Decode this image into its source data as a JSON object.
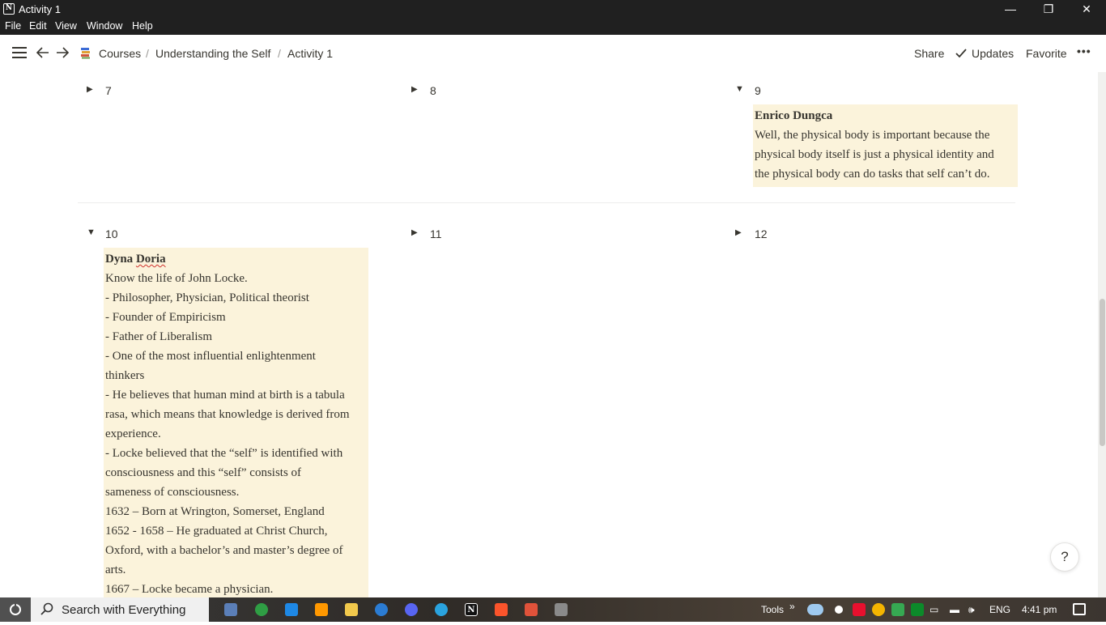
{
  "window": {
    "title": "Activity 1",
    "controls": {
      "minimize": "—",
      "restore": "❐",
      "close": "✕"
    }
  },
  "menu": [
    "File",
    "Edit",
    "View",
    "Window",
    "Help"
  ],
  "topbar": {
    "breadcrumb": [
      "Courses",
      "Understanding the Self",
      "Activity 1"
    ],
    "separator": "/",
    "share": "Share",
    "updates": "Updates",
    "favorite": "Favorite",
    "more": "•••"
  },
  "grid": {
    "row1": [
      {
        "number": "7",
        "expanded": false
      },
      {
        "number": "8",
        "expanded": false
      },
      {
        "number": "9",
        "expanded": true
      }
    ],
    "row2": [
      {
        "number": "10",
        "expanded": true
      },
      {
        "number": "11",
        "expanded": false
      },
      {
        "number": "12",
        "expanded": false
      }
    ]
  },
  "notes": {
    "n9": {
      "author": "Enrico Dungca",
      "lines": [
        "Well, the physical body is important because the",
        "physical body itself is just a physical identity and",
        "the physical body can do tasks that self can’t do."
      ]
    },
    "n10": {
      "author_first": "Dyna",
      "author_last": "Doria",
      "lines": [
        "Know the life of John Locke.",
        " - Philosopher, Physician, Political theorist",
        "- Founder of Empiricism",
        " - Father of Liberalism",
        " - One of the most influential enlightenment",
        "thinkers",
        "- He believes that human mind at birth is a tabula",
        "rasa, which means that knowledge is derived from",
        "experience.",
        "- Locke believed that the “self” is identified with",
        "consciousness and this “self” consists of",
        "sameness of consciousness.",
        "1632 – Born at Wrington, Somerset, England",
        "1652 - 1658 – He graduated at Christ Church,",
        "Oxford, with a bachelor’s and master’s degree of",
        "arts.",
        "1667 – Locke became a physician."
      ]
    }
  },
  "help_label": "?",
  "taskbar": {
    "search": "Search with Everything",
    "tools": "Tools",
    "lang": "ENG",
    "time": "4:41 pm"
  },
  "colors": {
    "note_bg": "#fbf3db",
    "text": "#37352f",
    "chrome": "#202020"
  }
}
